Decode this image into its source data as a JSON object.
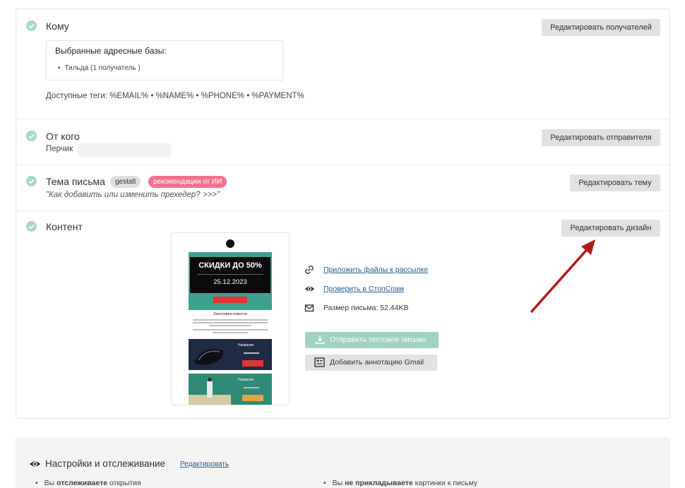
{
  "sections": {
    "recipients": {
      "title": "Кому",
      "edit_label": "Редактировать получателей",
      "address_book_title": "Выбранные адресные базы:",
      "address_books": [
        "Тильда (1 получатель )"
      ],
      "tags_line": "Доступные теги: %EMAIL% • %NAME% • %PHONE% • %PAYMENT%"
    },
    "sender": {
      "title": "От кого",
      "edit_label": "Редактировать отправителя",
      "name": "Перчик"
    },
    "subject": {
      "title": "Тема письма",
      "badges": [
        "gestalt",
        "рекомендации от ИИ"
      ],
      "preheader": "\"Как добавить или изменить прехедер? >>>\"",
      "edit_label": "Редактировать тему"
    },
    "content": {
      "title": "Контент",
      "edit_label": "Редактировать дизайн",
      "preview": {
        "sale_text": "СКИДКИ ДО 50%",
        "date": "25.12.2023",
        "news_title": "Заголовок новости",
        "products": [
          "Название",
          "Название"
        ]
      },
      "actions": {
        "attach_files": "Приложить файлы к рассылке",
        "check_spam": "Проверить в СтопСпам",
        "size_label": "Размер письма: 52.44KB"
      },
      "send_test": "Отправить тестовое письмо",
      "gmail_annotation": "Добавить аннотацию Gmail"
    }
  },
  "settings": {
    "title": "Настройки и отслеживание",
    "edit_link": "Редактировать",
    "item_left": {
      "pre": "Вы ",
      "bold": "отслеживаете",
      "post": " открытия"
    },
    "item_right": {
      "pre": "Вы ",
      "bold": "не прикладываете",
      "post": " картинки к письму"
    }
  },
  "colors": {
    "check": "#a7d6c7",
    "badge_pink": "#f0728f",
    "send_test": "#9fd3c0",
    "link": "#2b5c8c",
    "arrow": "#b81818"
  }
}
